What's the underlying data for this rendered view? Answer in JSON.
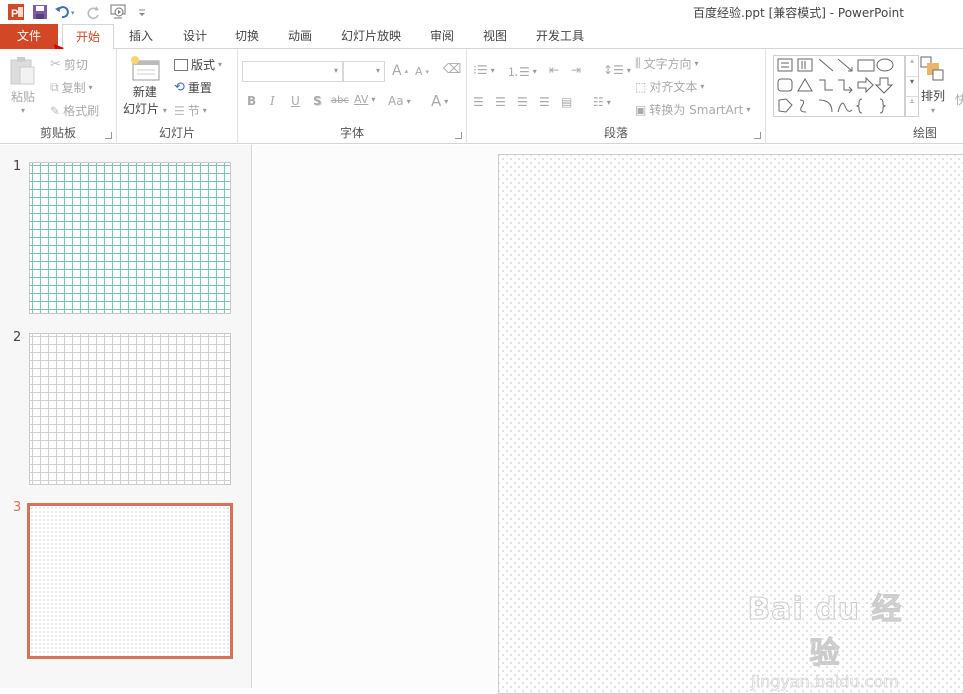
{
  "window": {
    "title": "百度经验.ppt [兼容模式] - PowerPoint"
  },
  "quick_access": [
    {
      "name": "powerpoint-logo-icon",
      "label": "P"
    },
    {
      "name": "save-icon"
    },
    {
      "name": "undo-icon"
    },
    {
      "name": "redo-icon"
    },
    {
      "name": "start-slideshow-icon"
    },
    {
      "name": "customize-qat-icon"
    }
  ],
  "tabs": {
    "file": "文件",
    "items": [
      "开始",
      "插入",
      "设计",
      "切换",
      "动画",
      "幻灯片放映",
      "审阅",
      "视图",
      "开发工具"
    ],
    "active": "开始"
  },
  "ribbon": {
    "clipboard": {
      "label": "剪贴板",
      "paste": "粘贴",
      "cut": "剪切",
      "copy": "复制",
      "format_painter": "格式刷"
    },
    "slides": {
      "label": "幻灯片",
      "new_slide_line1": "新建",
      "new_slide_line2": "幻灯片",
      "layout": "版式",
      "reset": "重置",
      "section": "节"
    },
    "font": {
      "label": "字体",
      "font_name_value": "",
      "font_size_value": "",
      "grow": "A",
      "shrink": "A",
      "bold": "B",
      "italic": "I",
      "underline": "U",
      "shadow": "S",
      "strike": "abc",
      "spacing": "AV",
      "change_case": "Aa",
      "font_color": "A"
    },
    "paragraph": {
      "label": "段落",
      "text_direction": "文字方向",
      "align_text": "对齐文本",
      "convert_smartart": "转换为 SmartArt"
    },
    "drawing": {
      "label": "绘图",
      "arrange": "排列",
      "quick_styles_partial": "快"
    }
  },
  "slides_pane": {
    "slides": [
      {
        "number": "1",
        "pattern": "teal-grid"
      },
      {
        "number": "2",
        "pattern": "gray-grid"
      },
      {
        "number": "3",
        "pattern": "dotted",
        "selected": true
      }
    ]
  },
  "watermark": {
    "logo": "Bai du 经验",
    "url": "jingyan.baidu.com"
  },
  "colors": {
    "accent": "#d24726",
    "selection_border": "#d5735a",
    "grid_teal": "#7fc4b8"
  }
}
